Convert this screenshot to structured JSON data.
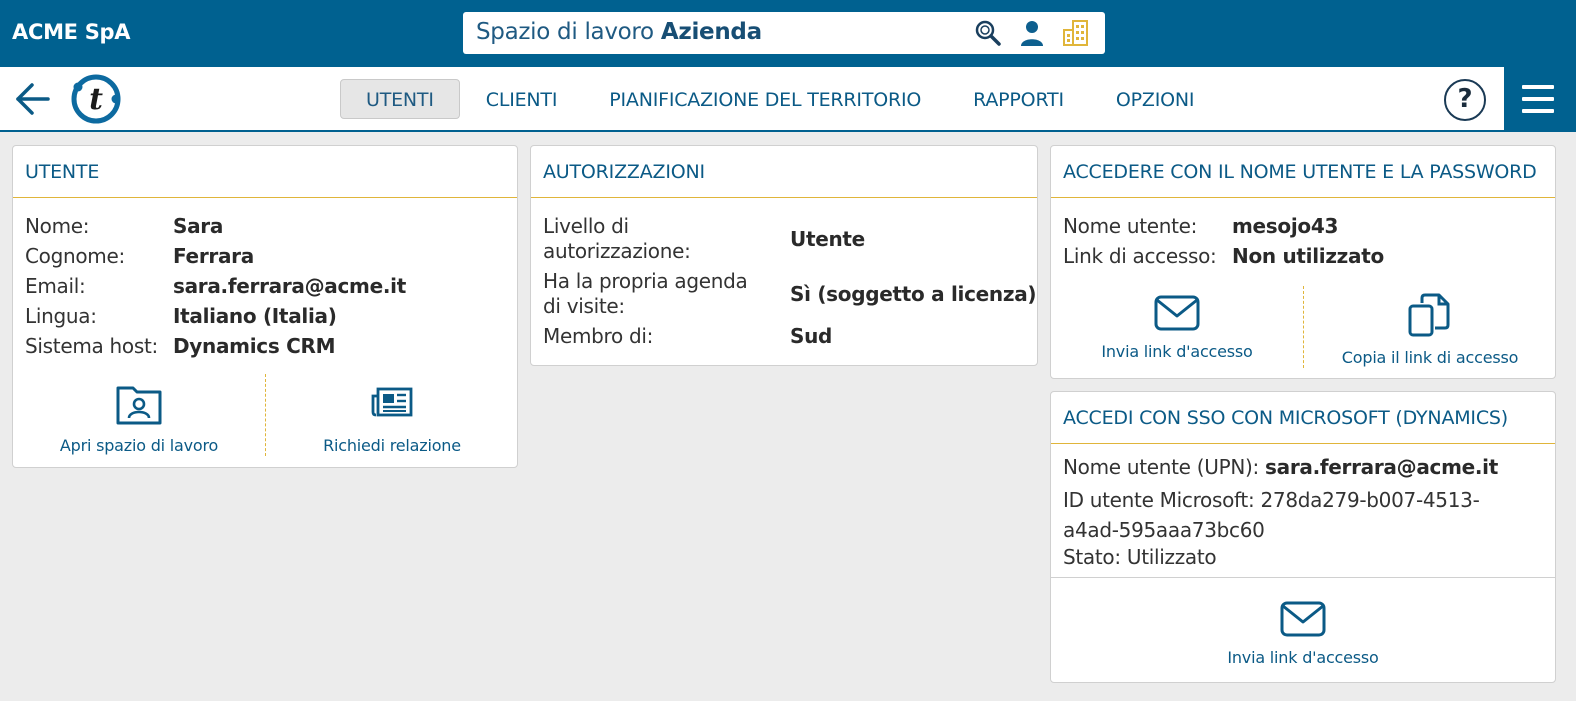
{
  "topbar": {
    "company": "ACME SpA",
    "workspace_prefix": "Spazio di lavoro",
    "workspace_name": "Azienda",
    "icons": [
      "search-icon",
      "user-icon",
      "building-icon"
    ]
  },
  "nav": {
    "tabs": [
      {
        "label": "UTENTI",
        "active": true
      },
      {
        "label": "CLIENTI",
        "active": false
      },
      {
        "label": "PIANIFICAZIONE DEL TERRITORIO",
        "active": false
      },
      {
        "label": "RAPPORTI",
        "active": false
      },
      {
        "label": "OPZIONI",
        "active": false
      }
    ],
    "help": "?"
  },
  "user_card": {
    "title": "UTENTE",
    "fields": [
      {
        "label": "Nome:",
        "value": "Sara"
      },
      {
        "label": "Cognome:",
        "value": "Ferrara"
      },
      {
        "label": "Email:",
        "value": "sara.ferrara@acme.it"
      },
      {
        "label": "Lingua:",
        "value": "Italiano (Italia)"
      },
      {
        "label": "Sistema host:",
        "value": "Dynamics CRM"
      }
    ],
    "actions": [
      {
        "label": "Apri spazio di lavoro",
        "icon": "user-folder-icon"
      },
      {
        "label": "Richiedi relazione",
        "icon": "newspaper-icon"
      }
    ]
  },
  "auth_card": {
    "title": "AUTORIZZAZIONI",
    "fields": [
      {
        "label_line1": "Livello di",
        "label_line2": "autorizzazione:",
        "value": "Utente"
      },
      {
        "label_line1": "Ha la propria agenda",
        "label_line2": "di visite:",
        "value": "Sì (soggetto a licenza)"
      },
      {
        "label_line1": "Membro di:",
        "label_line2": "",
        "value": "Sud"
      }
    ]
  },
  "login_card": {
    "title": "ACCEDERE CON IL NOME UTENTE E LA PASSWORD",
    "fields": [
      {
        "label": "Nome utente:",
        "value": "mesojo43"
      },
      {
        "label": "Link di accesso:",
        "value": "Non utilizzato"
      }
    ],
    "actions": [
      {
        "label": "Invia link d'accesso",
        "icon": "envelope-icon"
      },
      {
        "label": "Copia il link di accesso",
        "icon": "copy-icon"
      }
    ]
  },
  "sso_card": {
    "title": "ACCEDI CON SSO CON MICROSOFT (DYNAMICS)",
    "upn_label": "Nome utente (UPN):",
    "upn_value": "sara.ferrara@acme.it",
    "msid_line1": "ID utente Microsoft: 278da279-b007-4513-",
    "msid_line2": "a4ad-595aaa73bc60",
    "status": "Stato: Utilizzato",
    "action": {
      "label": "Invia link d'accesso",
      "icon": "envelope-icon"
    }
  },
  "colors": {
    "primary": "#006190",
    "accent": "#e0b53a",
    "text_link": "#0b5a86",
    "background": "#ececec"
  }
}
